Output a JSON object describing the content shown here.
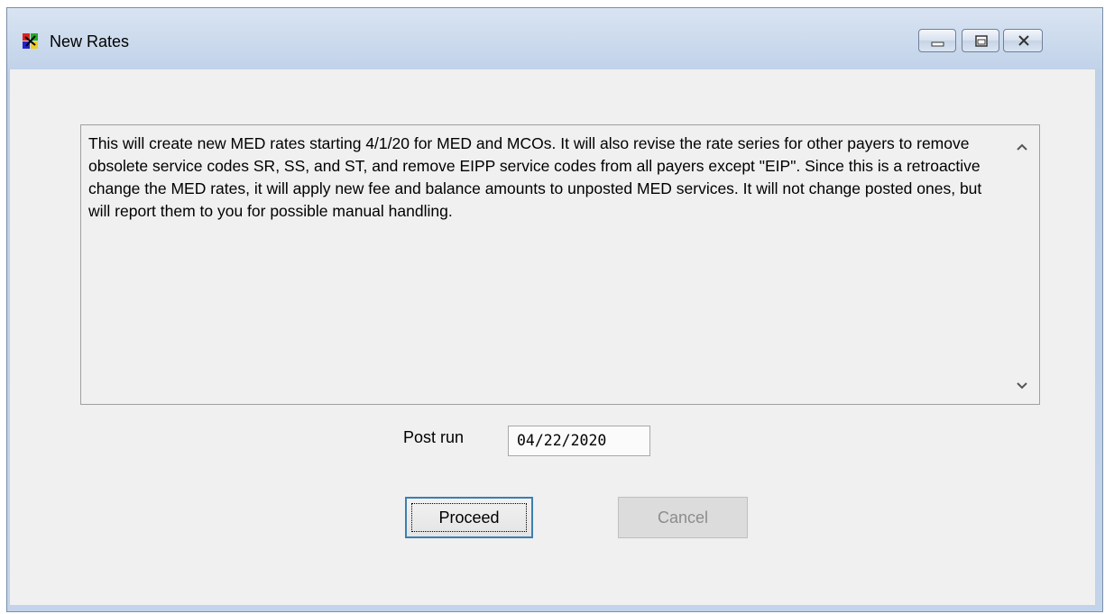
{
  "window": {
    "title": "New Rates",
    "controls": [
      "minimize",
      "maximize",
      "close"
    ]
  },
  "message": {
    "text": "This will create new MED rates starting 4/1/20 for MED and MCOs.  It will also revise the rate series for other payers to remove obsolete service codes SR, SS, and ST, and remove EIPP service codes from all payers except \"EIP\".  Since this is a retroactive change the MED rates, it will apply new fee and balance amounts to unposted MED services.  It will not change posted ones, but will report them to you for possible manual handling."
  },
  "post_run": {
    "label": "Post run",
    "value": "04/22/2020"
  },
  "buttons": {
    "proceed": "Proceed",
    "cancel": "Cancel"
  },
  "icons": {
    "app": "app-icon",
    "scroll_up": "chevron-up-icon",
    "scroll_down": "chevron-down-icon"
  }
}
